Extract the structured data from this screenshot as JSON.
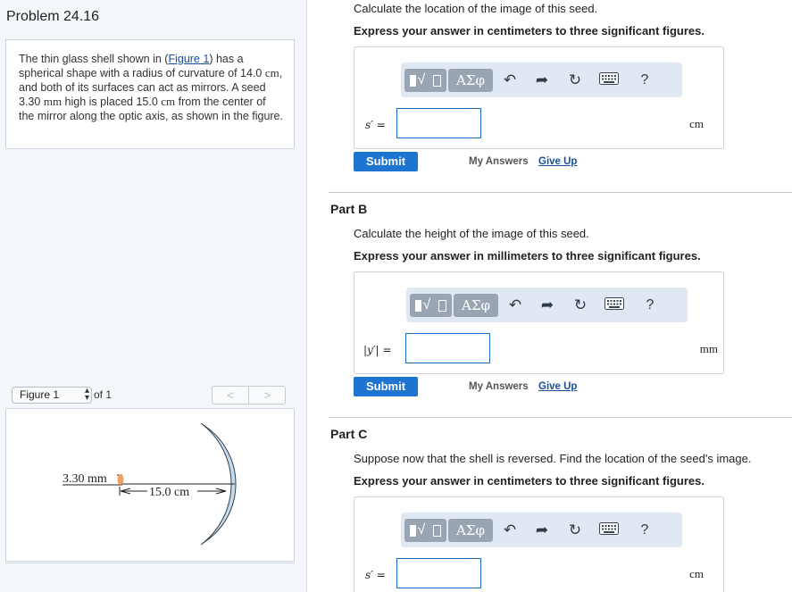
{
  "problem": {
    "title": "Problem 24.16",
    "text_intro": "The thin glass shell shown in (",
    "figure_link": "Figure 1",
    "text_a": ") has a spherical shape with a radius of curvature of 14.0",
    "unit_cm1": "cm",
    "text_b": ", and both of its surfaces can act as mirrors. A seed 3.30",
    "unit_mm": "mm",
    "text_c": "high is placed 15.0",
    "unit_cm2": "cm",
    "text_d": "from the center of the mirror along the optic axis, as shown in the figure."
  },
  "figure_nav": {
    "selected": "Figure 1",
    "of_label": "of 1",
    "prev": "<",
    "next": ">"
  },
  "figure": {
    "seed_height_label": "3.30 mm",
    "distance_label": "15.0 cm",
    "colors": {
      "shell_fill": "#c7dbeb",
      "shell_stroke": "#2f3f50",
      "seed": "#f0a060"
    }
  },
  "toolbar": {
    "greek": "ΑΣφ",
    "undo": "↶",
    "redo": "➦",
    "reset": "↻",
    "help": "?"
  },
  "partA": {
    "question": "Calculate the location of the image of this seed.",
    "instruction": "Express your answer in centimeters to three significant figures.",
    "var_label": "s′ =",
    "value": "",
    "unit": "cm"
  },
  "partB": {
    "title": "Part B",
    "question": "Calculate the height of the image of this seed.",
    "instruction": "Express your answer in millimeters to three significant figures.",
    "var_label": "|y′| =",
    "value": "",
    "unit": "mm"
  },
  "partC": {
    "title": "Part C",
    "question": "Suppose now that the shell is reversed. Find the location of the seed's image.",
    "instruction": "Express your answer in centimeters to three significant figures.",
    "var_label": "s′ =",
    "value": "",
    "unit": "cm"
  },
  "actions": {
    "submit": "Submit",
    "my_answers": "My Answers",
    "give_up": "Give Up"
  }
}
